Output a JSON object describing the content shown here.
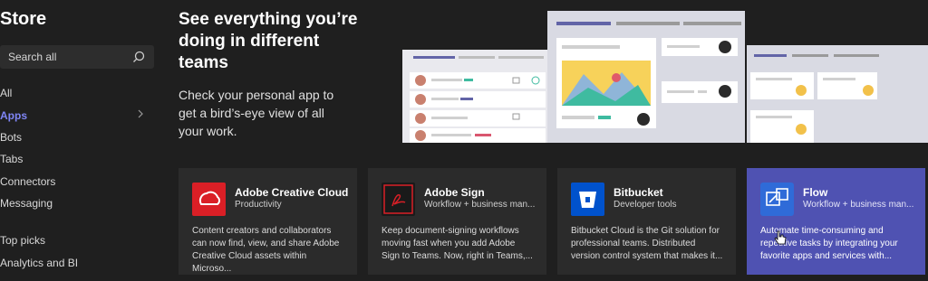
{
  "sidebar": {
    "title": "Store",
    "search_placeholder": "Search all",
    "items": [
      {
        "label": "All"
      },
      {
        "label": "Apps"
      },
      {
        "label": "Bots"
      },
      {
        "label": "Tabs"
      },
      {
        "label": "Connectors"
      },
      {
        "label": "Messaging"
      },
      {
        "label": "Top picks"
      },
      {
        "label": "Analytics and BI"
      }
    ]
  },
  "hero": {
    "title": "See everything you’re doing in different teams",
    "subtitle": "Check your personal app to get a bird’s-eye view of all your work."
  },
  "apps": [
    {
      "name": "Adobe Creative Cloud",
      "category": "Productivity",
      "description": "Content creators and collaborators can now find, view, and share Adobe Creative Cloud assets within Microso..."
    },
    {
      "name": "Adobe Sign",
      "category": "Workflow + business man...",
      "description": "Keep document-signing workflows moving fast when you add Adobe Sign to Teams. Now, right in Teams,..."
    },
    {
      "name": "Bitbucket",
      "category": "Developer tools",
      "description": "Bitbucket Cloud is the Git solution for professional teams. Distributed version control system that makes it..."
    },
    {
      "name": "Flow",
      "category": "Workflow + business man...",
      "description": "Automate time-consuming and repetitive tasks by integrating your favorite apps and services with..."
    }
  ],
  "colors": {
    "accent": "#7f85f5",
    "flow_card": "#4f52b2",
    "adobe_red": "#da1f26",
    "bitbucket_blue": "#0052cc"
  }
}
